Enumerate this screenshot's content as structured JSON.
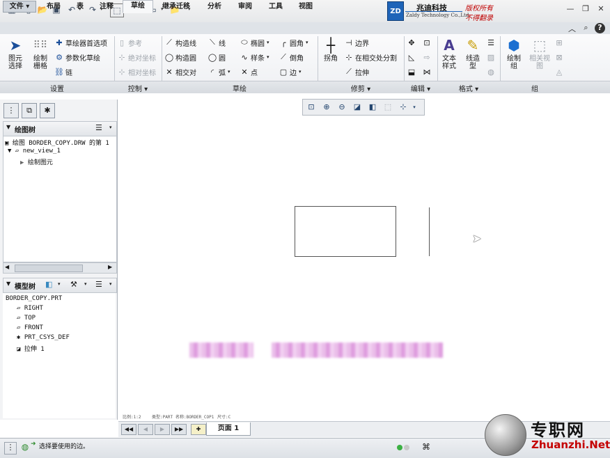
{
  "brand": {
    "logo_letters": "ZD",
    "company_cn": "兆迪科技",
    "company_en": "Zaldy Technology Co.,Ltd.",
    "copyright_line1": "版权所有",
    "copyright_line2": "不得翻录"
  },
  "tabs": [
    {
      "label": "文件 ▾",
      "state": "file"
    },
    {
      "label": "布局",
      "state": "normal"
    },
    {
      "label": "表",
      "state": "normal"
    },
    {
      "label": "注释",
      "state": "normal"
    },
    {
      "label": "草绘",
      "state": "active"
    },
    {
      "label": "继承迁移",
      "state": "normal"
    },
    {
      "label": "分析",
      "state": "normal"
    },
    {
      "label": "审阅",
      "state": "normal"
    },
    {
      "label": "工具",
      "state": "normal"
    },
    {
      "label": "视图",
      "state": "normal"
    }
  ],
  "ribbon": {
    "settings": {
      "select_line1": "图元",
      "select_line2": "选择",
      "grid_line1": "绘制",
      "grid_line2": "栅格",
      "prefs": "草绘器首选项",
      "parametric": "参数化草绘",
      "chain": "链"
    },
    "control": {
      "reference": "参考",
      "absolute": "绝对坐标",
      "relative": "相对坐标"
    },
    "sketch": {
      "construct_line": "构造线",
      "construct_circle": "构造圆",
      "intersect": "相交对",
      "line": "线",
      "circle": "圆",
      "arc": "弧",
      "ellipse": "椭圆",
      "spline": "样条",
      "point": "点",
      "fillet": "圆角",
      "chamfer": "倒角",
      "edge": "边"
    },
    "trim": {
      "corner": "拐角",
      "boundary": "边界",
      "split": "在相交处分割",
      "stretch": "拉伸"
    },
    "format": {
      "text_style_line1": "文本",
      "text_style_line2": "样式",
      "line_style_line1": "线造",
      "line_style_line2": "型"
    },
    "group": {
      "draw_group_line1": "绘制",
      "draw_group_line2": "组",
      "related_view_line1": "相关视",
      "related_view_line2": "图"
    },
    "group_labels": {
      "settings": "设置",
      "control": "控制 ▾",
      "sketch": "草绘",
      "trim": "修剪 ▾",
      "edit": "编辑 ▾",
      "format": "格式 ▾",
      "group": "组"
    }
  },
  "panel": {
    "drawing_tree_title": "绘图树",
    "drawing_tree_items": [
      {
        "label": "绘图 BORDER_COPY.DRW 的第 1",
        "indent": 0
      },
      {
        "label": "new_view_1",
        "indent": 1
      },
      {
        "label": "绘制图元",
        "indent": 2
      }
    ],
    "model_tree_title": "模型树",
    "model_tree_items": [
      {
        "label": "BORDER_COPY.PRT",
        "indent": 0
      },
      {
        "label": "RIGHT",
        "indent": 1
      },
      {
        "label": "TOP",
        "indent": 1
      },
      {
        "label": "FRONT",
        "indent": 1
      },
      {
        "label": "PRT_CSYS_DEF",
        "indent": 1
      },
      {
        "label": "拉伸 1",
        "indent": 1
      }
    ]
  },
  "graphics": {
    "info_scale": "比例:1:2",
    "info_type": "类型:PART",
    "info_name": "名称:BORDER_COP1",
    "info_size": "尺寸:C"
  },
  "page_nav": {
    "page_label": "页面 1"
  },
  "status": {
    "message": "选择要使用的边。"
  },
  "watermark": {
    "cn": "专职网",
    "en": "Zhuanzhi.Net"
  }
}
